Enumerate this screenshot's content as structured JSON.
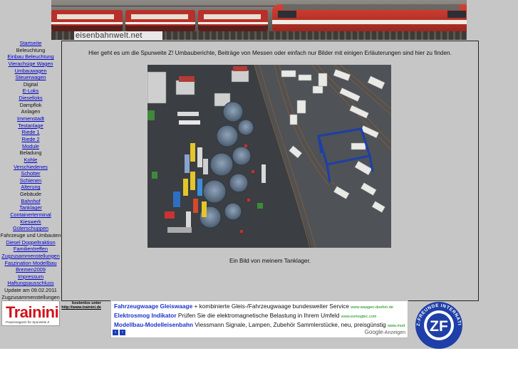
{
  "header": {
    "site_name": "eisenbahnwelt.net"
  },
  "nav": {
    "items": [
      {
        "label": "Startseite",
        "link": true
      },
      {
        "label": "Beleuchtung",
        "link": false
      },
      {
        "label": "Einbau Beleuchtung",
        "link": true
      },
      {
        "label": "Vierachsige Wagen",
        "link": true
      },
      {
        "label": "Umbauwagen",
        "link": true
      },
      {
        "label": "Steuerwagen",
        "link": true
      },
      {
        "label": "Digital",
        "link": false
      },
      {
        "label": "E-Loks",
        "link": true
      },
      {
        "label": "Dieselloks",
        "link": true
      },
      {
        "label": "Dampflok",
        "link": false
      },
      {
        "label": "Anlagen",
        "link": false
      },
      {
        "label": "Immenstadt",
        "link": true
      },
      {
        "label": "Testanlage",
        "link": true
      },
      {
        "label": "Riede 1",
        "link": true
      },
      {
        "label": "Riede 2",
        "link": true
      },
      {
        "label": "Module",
        "link": true
      },
      {
        "label": "Beladung",
        "link": false
      },
      {
        "label": "Kohle",
        "link": true
      },
      {
        "label": "Verschiedenes",
        "link": true
      },
      {
        "label": "Schotter",
        "link": true
      },
      {
        "label": "Schienen",
        "link": true
      },
      {
        "label": "Alterung",
        "link": true
      },
      {
        "label": "Gebäude",
        "link": false
      },
      {
        "label": "Bahnhof",
        "link": true
      },
      {
        "label": "Tanklager",
        "link": true
      },
      {
        "label": "Containerterminal",
        "link": true
      },
      {
        "label": "Kieswerk",
        "link": true
      },
      {
        "label": "Güterschuppen",
        "link": true
      },
      {
        "label": "Fahrzeuge und Umbauten",
        "link": false
      },
      {
        "label": "Diesel Doppeltraktion",
        "link": true
      },
      {
        "label": "Familientreffen",
        "link": true
      },
      {
        "label": "Zugzusammenstellungen",
        "link": true
      },
      {
        "label": "Faszination Modellbau",
        "link": true
      },
      {
        "label": "Bremen2009",
        "link": true
      },
      {
        "label": "Impressum",
        "link": true
      },
      {
        "label": "Haftungsausschluss",
        "link": true
      },
      {
        "label": "Update am 09.02.2011",
        "link": false
      },
      {
        "label": "Zugzusammenstellungen",
        "link": false
      }
    ]
  },
  "main": {
    "intro": "Hier geht es um die Spurweite Z! Umbauberichte, Beiträge von Messen oder einfach nur Bilder mit einigen Erläuterungen sind hier zu finden.",
    "caption": "Ein Bild von meinem Tanklager."
  },
  "footer": {
    "trainini": {
      "logo": "Trainini",
      "tagline": "Praxismagazin für Spurweite Z"
    },
    "free_note": {
      "line1": "kostenlos unter",
      "line2": "http://www.trainini.de"
    },
    "ads": [
      {
        "title": "Fahrzeugwaage Gleiswaage",
        "desc": " + kombinierte Gleis-/Fahrzeugwaage bundesweiter Service ",
        "url": "www.waagen-doehm.de"
      },
      {
        "title": "Elektrosmog Indikator",
        "desc": " Prüfen Sie die elektromagnetische Belastung in Ihrem Umfeld ",
        "url": "www.esmogtec.com"
      },
      {
        "title": "Modellbau-Modelleisenbahn",
        "desc": " Viessmann Signale, Lampen, Zubehör Sammlerstücke, neu, preisgünstig ",
        "url": "www.mod..."
      }
    ],
    "ads_prev": "‹",
    "ads_next": "›",
    "google_brand": "Google",
    "google_suffix": "-Anzeigen",
    "zf_logo": {
      "ring_text": "Z-FREUNDE INTERNATIONAL",
      "initials": "ZF"
    }
  },
  "colors": {
    "page_bg": "#c6c6c6",
    "link": "#0000cc",
    "ad_title": "#1a33cc",
    "ad_url": "#0a8a0a",
    "trainini_red": "#d1121a",
    "zf_blue": "#1f3fa8"
  }
}
